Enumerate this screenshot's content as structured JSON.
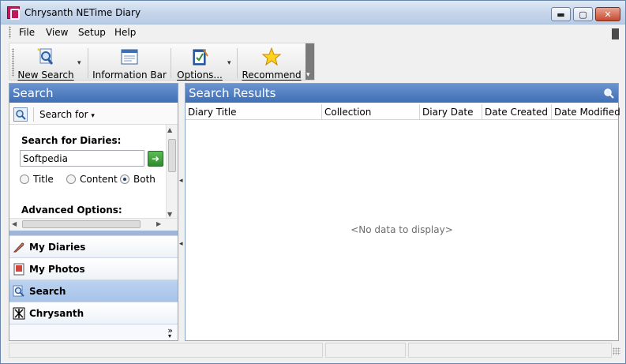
{
  "window": {
    "title": "Chrysanth NETime Diary"
  },
  "window_controls": {
    "minimize": "▬",
    "maximize": "▢",
    "close": "✕"
  },
  "menu": {
    "items": [
      "File",
      "View",
      "Setup",
      "Help"
    ]
  },
  "toolbar": {
    "new_search": "New Search",
    "information_bar": "Information Bar",
    "options": "Options...",
    "recommend": "Recommend"
  },
  "left_panel": {
    "header": "Search",
    "search_for_label": "Search for",
    "search_for_diaries_label": "Search for Diaries:",
    "search_value": "Softpedia",
    "radio": {
      "title": "Title",
      "content": "Content",
      "both": "Both",
      "selected": "both"
    },
    "advanced_options": "Advanced Options:"
  },
  "nav": {
    "items": [
      "My Diaries",
      "My Photos",
      "Search",
      "Chrysanth"
    ],
    "active": "Search",
    "more": "»"
  },
  "right_panel": {
    "header": "Search Results",
    "columns": [
      "Diary Title",
      "Collection",
      "Diary Date",
      "Date Created",
      "Date Modified"
    ],
    "empty_message": "<No data to display>"
  },
  "colors": {
    "header_blue": "#3f6fb5",
    "active_nav": "#a7c3ea",
    "close_red": "#c64a2e"
  }
}
